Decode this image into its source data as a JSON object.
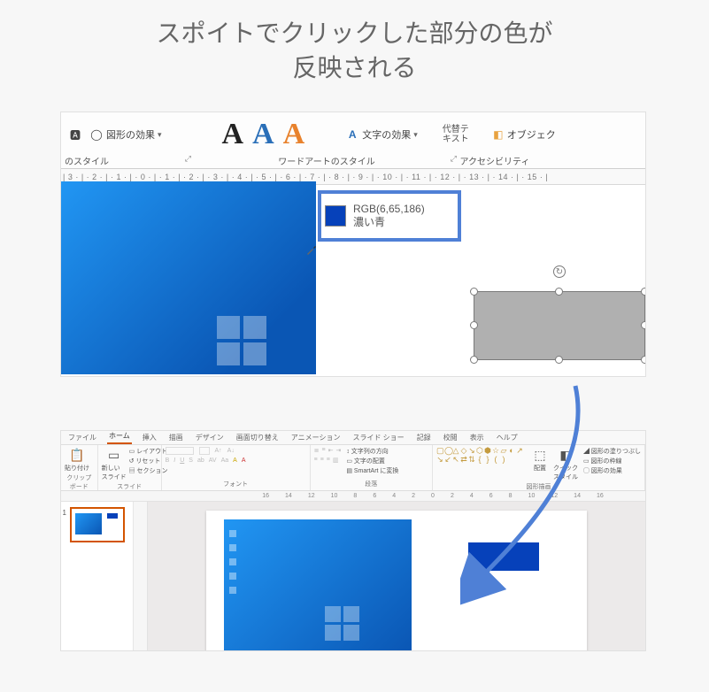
{
  "title_line1": "スポイトでクリックした部分の色が",
  "title_line2": "反映される",
  "img1": {
    "ribbon": {
      "shape_effects": "図形の効果",
      "text_effects": "文字の効果",
      "alt_text_l1": "代替テ",
      "alt_text_l2": "キスト",
      "object_btn": "オブジェク",
      "group_shape_styles": "のスタイル",
      "group_wordart": "ワードアートのスタイル",
      "group_accessibility": "アクセシビリティ",
      "expand_char": "⤢"
    },
    "ruler_text": "| 3 · | · 2 · | · 1 · | · 0 · | · 1 · | · 2 · | · 3 · | · 4 · | · 5 · | · 6 · | · 7 · | · 8 · | · 9 · | · 10 · | · 11 · | · 12 · | · 13 · | · 14 · | · 15 · |",
    "tooltip_rgb": "RGB(6,65,186)",
    "tooltip_name": "濃い青"
  },
  "img2": {
    "tabs": {
      "file": "ファイル",
      "home": "ホーム",
      "insert": "挿入",
      "draw": "描画",
      "design": "デザイン",
      "transitions": "画面切り替え",
      "animations": "アニメーション",
      "slideshow": "スライド ショー",
      "record": "記録",
      "review": "校閲",
      "view": "表示",
      "help": "ヘルプ"
    },
    "groups": {
      "clipboard": "クリップボード",
      "slides": "スライド",
      "font": "フォント",
      "paragraph": "段落",
      "drawing": "図形描画"
    },
    "buttons": {
      "paste": "貼り付け",
      "new_slide": "新しい\nスライド",
      "layout": "レイアウト",
      "reset": "リセット",
      "section": "セクション",
      "text_direction": "文字列の方向",
      "align_text": "文字の配置",
      "smartart": "SmartArt に変換",
      "arrange": "配置",
      "quick_styles": "クイック\nスタイル",
      "shape_fill": "図形の塗りつぶし",
      "shape_outline": "図形の枠線",
      "shape_effects": "図形の効果"
    },
    "ruler2_marks": [
      "16",
      "14",
      "12",
      "10",
      "8",
      "6",
      "4",
      "2",
      "0",
      "2",
      "4",
      "6",
      "8",
      "10",
      "12",
      "14",
      "16"
    ],
    "thumb_number": "1"
  }
}
